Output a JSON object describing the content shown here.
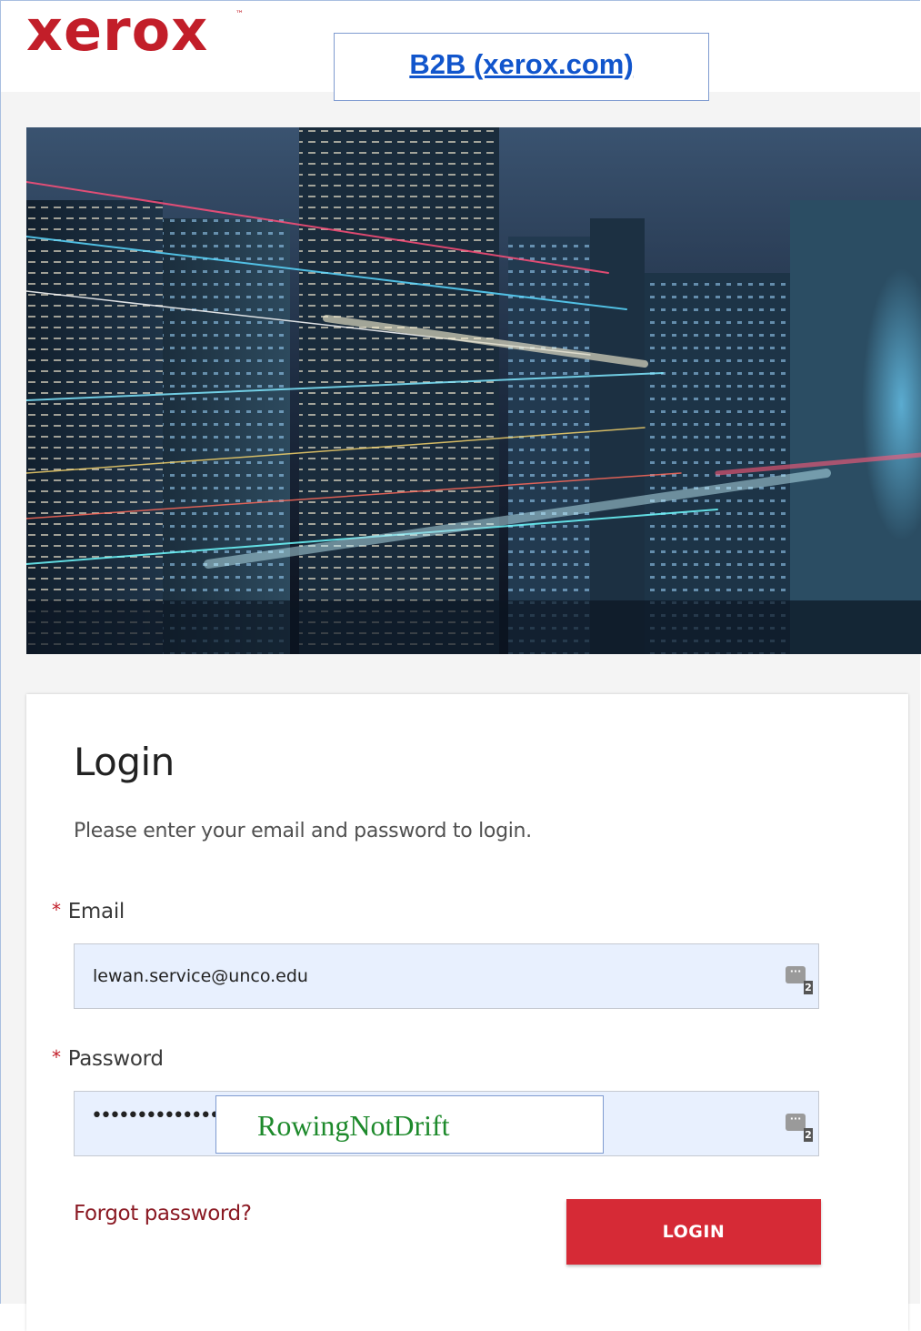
{
  "header": {
    "logo_text": "xerox",
    "logo_tm": "™",
    "link_text": "B2B (xerox.com)"
  },
  "colors": {
    "brand_red": "#c21e29",
    "button_red": "#d62a36",
    "link_blue": "#1155cc",
    "autofill_blue": "#e8f0fe",
    "overlay_green": "#1e8a2c"
  },
  "login": {
    "title": "Login",
    "subtitle": "Please enter your email and password to login.",
    "email_label": "Email",
    "email_value": "lewan.service@unco.edu",
    "password_label": "Password",
    "password_masked": "••••••••••••••••",
    "password_manager_count": "2",
    "required_marker": "*",
    "forgot_label": "Forgot password?",
    "login_button": "LOGIN"
  },
  "overlay": {
    "text": "RowingNotDrift"
  },
  "icons": {
    "password_manager": "key-bubble-icon"
  }
}
